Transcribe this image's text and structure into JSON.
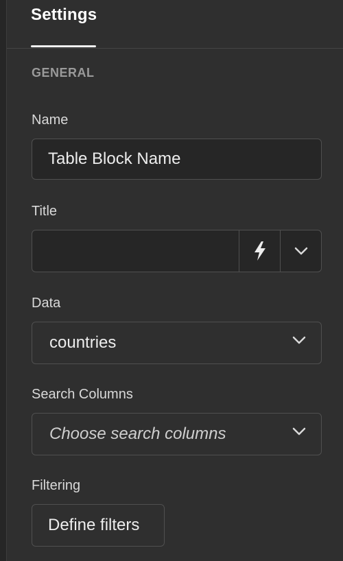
{
  "header": {
    "tab_label": "Settings"
  },
  "section": {
    "title": "GENERAL"
  },
  "fields": {
    "name": {
      "label": "Name",
      "value": "Table Block Name"
    },
    "title": {
      "label": "Title",
      "value": ""
    },
    "data": {
      "label": "Data",
      "value": "countries"
    },
    "search_columns": {
      "label": "Search Columns",
      "placeholder": "Choose search columns"
    },
    "filtering": {
      "label": "Filtering",
      "button_label": "Define filters"
    }
  },
  "icons": {
    "bolt": "lightning-bolt-icon",
    "chevron": "chevron-down-icon"
  },
  "colors": {
    "background": "#2f2f2f",
    "input_bg": "#262626",
    "border": "#505050",
    "section_title": "#9a9a9a",
    "text": "#ededed"
  }
}
